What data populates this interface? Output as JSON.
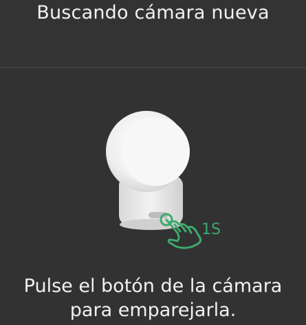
{
  "header": {
    "title": "Buscando cámara nueva"
  },
  "illustration": {
    "icon": "camera-pairing-illustration",
    "hand_icon": "hand-press-icon",
    "hold_time_label": "1S",
    "accent_color": "#3ea96d"
  },
  "instruction": {
    "line1": "Pulse el botón de la cámara",
    "line2": "para emparejarla."
  }
}
